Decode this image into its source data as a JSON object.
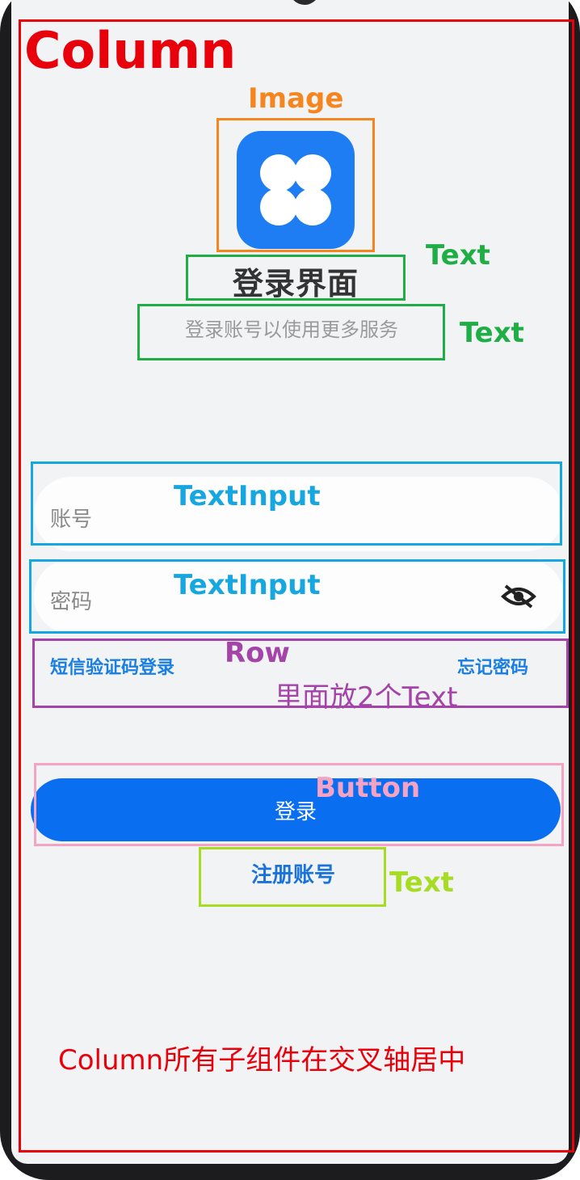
{
  "app": {
    "logo_icon": "four-petal-clover-icon",
    "brand_color": "#0a6ef0",
    "title": "登录界面",
    "subtitle": "登录账号以使用更多服务"
  },
  "form": {
    "account_placeholder": "账号",
    "password_placeholder": "密码",
    "password_toggle_icon": "eye-off-icon",
    "sms_login_label": "短信验证码登录",
    "forgot_password_label": "忘记密码",
    "login_button_label": "登录",
    "register_label": "注册账号"
  },
  "annotations": {
    "column_label": "Column",
    "image_label": "Image",
    "title_text_label": "Text",
    "subtitle_text_label": "Text",
    "account_input_label": "TextInput",
    "password_input_label": "TextInput",
    "row_label": "Row",
    "row_note": "里面放2个Text",
    "button_label": "Button",
    "register_text_label": "Text",
    "column_note": "Column所有子组件在交叉轴居中",
    "colors": {
      "column": "#e8000b",
      "image": "#f5861f",
      "text": "#1fae46",
      "textinput": "#16a6e0",
      "row": "#a544a8",
      "button": "#f4a3c4",
      "register_text": "#a6dc21"
    }
  }
}
